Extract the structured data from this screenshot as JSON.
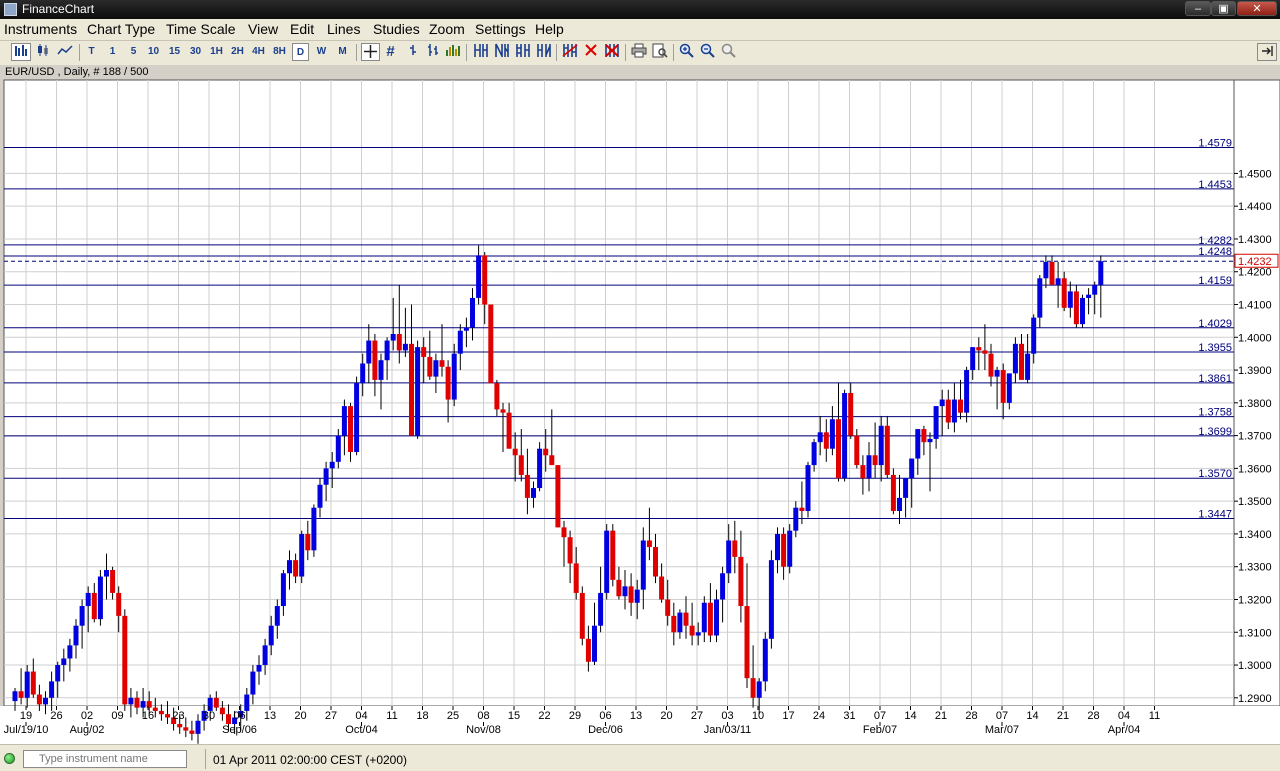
{
  "window": {
    "title": "FinanceChart"
  },
  "menu": [
    "Instruments",
    "Chart Type",
    "Time Scale",
    "View",
    "Edit",
    "Lines",
    "Studies",
    "Zoom",
    "Settings",
    "Help"
  ],
  "toolbar": {
    "timeframes": [
      "T",
      "1",
      "5",
      "10",
      "15",
      "30",
      "1H",
      "2H",
      "4H",
      "8H",
      "D",
      "W",
      "M"
    ],
    "selected_timeframe": "D",
    "hash": "#"
  },
  "symbol_info": "EUR/USD , Daily, # 188 / 500",
  "status": {
    "search_placeholder": "Type instrument name",
    "datetime": "01 Apr 2011 02:00:00  CEST (+0200)"
  },
  "colors": {
    "up": "#0000e0",
    "down": "#e00000",
    "line": "#00007a",
    "grid": "#cfcfcf",
    "current": "#d40000"
  },
  "chart_data": {
    "type": "candlestick",
    "ylim": [
      1.2875,
      1.4785
    ],
    "y_ticks": [
      1.29,
      1.3,
      1.31,
      1.32,
      1.33,
      1.34,
      1.35,
      1.36,
      1.37,
      1.38,
      1.39,
      1.4,
      1.41,
      1.42,
      1.43,
      1.44,
      1.45
    ],
    "x_ticks": [
      "19",
      "26",
      "02",
      "09",
      "16",
      "23",
      "30",
      "06",
      "13",
      "20",
      "27",
      "04",
      "11",
      "18",
      "25",
      "08",
      "15",
      "22",
      "29",
      "06",
      "13",
      "20",
      "27",
      "03",
      "10",
      "17",
      "24",
      "31",
      "07",
      "14",
      "21",
      "28",
      "07",
      "14",
      "21",
      "28",
      "04",
      "11"
    ],
    "x_month_labels": [
      {
        "label": "Jul/19/10",
        "at": 0
      },
      {
        "label": "Aug/02",
        "at": 2
      },
      {
        "label": "Sep/06",
        "at": 7
      },
      {
        "label": "Oct/04",
        "at": 11
      },
      {
        "label": "Nov/08",
        "at": 15
      },
      {
        "label": "Dec/06",
        "at": 19
      },
      {
        "label": "Jan/03/11",
        "at": 23
      },
      {
        "label": "Feb/07",
        "at": 28
      },
      {
        "label": "Mar/07",
        "at": 32
      },
      {
        "label": "Apr/04",
        "at": 36
      }
    ],
    "horizontal_lines": [
      1.4579,
      1.4453,
      1.4282,
      1.4248,
      1.4159,
      1.4029,
      1.3955,
      1.3861,
      1.3758,
      1.3699,
      1.357,
      1.3447
    ],
    "current_price": 1.4232,
    "candles": [
      [
        1.289,
        1.293,
        1.286,
        1.292
      ],
      [
        1.292,
        1.299,
        1.288,
        1.29
      ],
      [
        1.29,
        1.3,
        1.287,
        1.298
      ],
      [
        1.298,
        1.302,
        1.29,
        1.291
      ],
      [
        1.291,
        1.294,
        1.286,
        1.288
      ],
      [
        1.288,
        1.292,
        1.285,
        1.29
      ],
      [
        1.29,
        1.298,
        1.286,
        1.295
      ],
      [
        1.295,
        1.301,
        1.29,
        1.3
      ],
      [
        1.3,
        1.305,
        1.295,
        1.302
      ],
      [
        1.302,
        1.308,
        1.298,
        1.306
      ],
      [
        1.306,
        1.314,
        1.302,
        1.312
      ],
      [
        1.312,
        1.32,
        1.305,
        1.318
      ],
      [
        1.318,
        1.324,
        1.31,
        1.322
      ],
      [
        1.322,
        1.325,
        1.313,
        1.314
      ],
      [
        1.314,
        1.329,
        1.312,
        1.327
      ],
      [
        1.327,
        1.334,
        1.32,
        1.329
      ],
      [
        1.329,
        1.33,
        1.32,
        1.322
      ],
      [
        1.322,
        1.324,
        1.31,
        1.315
      ],
      [
        1.315,
        1.317,
        1.286,
        1.288
      ],
      [
        1.288,
        1.293,
        1.284,
        1.29
      ],
      [
        1.29,
        1.292,
        1.285,
        1.287
      ],
      [
        1.287,
        1.293,
        1.284,
        1.289
      ],
      [
        1.289,
        1.292,
        1.285,
        1.287
      ],
      [
        1.287,
        1.29,
        1.284,
        1.286
      ],
      [
        1.286,
        1.288,
        1.283,
        1.285
      ],
      [
        1.285,
        1.289,
        1.282,
        1.284
      ],
      [
        1.284,
        1.287,
        1.28,
        1.282
      ],
      [
        1.282,
        1.285,
        1.279,
        1.281
      ],
      [
        1.281,
        1.284,
        1.278,
        1.28
      ],
      [
        1.28,
        1.283,
        1.277,
        1.279
      ],
      [
        1.279,
        1.285,
        1.276,
        1.283
      ],
      [
        1.283,
        1.288,
        1.28,
        1.286
      ],
      [
        1.286,
        1.291,
        1.283,
        1.29
      ],
      [
        1.29,
        1.292,
        1.286,
        1.287
      ],
      [
        1.287,
        1.289,
        1.283,
        1.285
      ],
      [
        1.285,
        1.288,
        1.28,
        1.282
      ],
      [
        1.282,
        1.286,
        1.279,
        1.284
      ],
      [
        1.284,
        1.288,
        1.28,
        1.286
      ],
      [
        1.286,
        1.293,
        1.283,
        1.291
      ],
      [
        1.291,
        1.3,
        1.288,
        1.298
      ],
      [
        1.298,
        1.303,
        1.294,
        1.3
      ],
      [
        1.3,
        1.308,
        1.297,
        1.306
      ],
      [
        1.306,
        1.315,
        1.303,
        1.312
      ],
      [
        1.312,
        1.32,
        1.308,
        1.318
      ],
      [
        1.318,
        1.329,
        1.315,
        1.328
      ],
      [
        1.328,
        1.335,
        1.323,
        1.332
      ],
      [
        1.332,
        1.334,
        1.325,
        1.327
      ],
      [
        1.327,
        1.341,
        1.325,
        1.34
      ],
      [
        1.34,
        1.344,
        1.332,
        1.335
      ],
      [
        1.335,
        1.349,
        1.333,
        1.348
      ],
      [
        1.348,
        1.357,
        1.345,
        1.355
      ],
      [
        1.355,
        1.362,
        1.35,
        1.36
      ],
      [
        1.36,
        1.365,
        1.354,
        1.362
      ],
      [
        1.362,
        1.372,
        1.36,
        1.37
      ],
      [
        1.37,
        1.381,
        1.364,
        1.379
      ],
      [
        1.379,
        1.38,
        1.362,
        1.365
      ],
      [
        1.365,
        1.388,
        1.364,
        1.386
      ],
      [
        1.386,
        1.395,
        1.382,
        1.392
      ],
      [
        1.392,
        1.404,
        1.386,
        1.399
      ],
      [
        1.399,
        1.401,
        1.382,
        1.387
      ],
      [
        1.387,
        1.395,
        1.378,
        1.393
      ],
      [
        1.393,
        1.4,
        1.387,
        1.399
      ],
      [
        1.399,
        1.412,
        1.396,
        1.401
      ],
      [
        1.401,
        1.416,
        1.392,
        1.396
      ],
      [
        1.396,
        1.409,
        1.394,
        1.398
      ],
      [
        1.398,
        1.41,
        1.372,
        1.37
      ],
      [
        1.37,
        1.399,
        1.369,
        1.397
      ],
      [
        1.397,
        1.4,
        1.386,
        1.394
      ],
      [
        1.394,
        1.402,
        1.387,
        1.388
      ],
      [
        1.388,
        1.395,
        1.383,
        1.393
      ],
      [
        1.393,
        1.404,
        1.388,
        1.391
      ],
      [
        1.391,
        1.393,
        1.374,
        1.381
      ],
      [
        1.381,
        1.398,
        1.379,
        1.395
      ],
      [
        1.395,
        1.404,
        1.39,
        1.402
      ],
      [
        1.402,
        1.406,
        1.397,
        1.403
      ],
      [
        1.403,
        1.415,
        1.399,
        1.412
      ],
      [
        1.412,
        1.428,
        1.41,
        1.425
      ],
      [
        1.425,
        1.426,
        1.404,
        1.41
      ],
      [
        1.41,
        1.409,
        1.39,
        1.386
      ],
      [
        1.386,
        1.387,
        1.376,
        1.378
      ],
      [
        1.378,
        1.38,
        1.365,
        1.377
      ],
      [
        1.377,
        1.38,
        1.366,
        1.366
      ],
      [
        1.366,
        1.371,
        1.356,
        1.364
      ],
      [
        1.364,
        1.372,
        1.356,
        1.358
      ],
      [
        1.358,
        1.366,
        1.346,
        1.351
      ],
      [
        1.351,
        1.356,
        1.348,
        1.354
      ],
      [
        1.354,
        1.368,
        1.353,
        1.366
      ],
      [
        1.366,
        1.372,
        1.359,
        1.364
      ],
      [
        1.364,
        1.378,
        1.361,
        1.361
      ],
      [
        1.361,
        1.361,
        1.342,
        1.342
      ],
      [
        1.342,
        1.344,
        1.33,
        1.339
      ],
      [
        1.339,
        1.341,
        1.325,
        1.331
      ],
      [
        1.331,
        1.336,
        1.32,
        1.322
      ],
      [
        1.322,
        1.324,
        1.306,
        1.308
      ],
      [
        1.308,
        1.312,
        1.298,
        1.301
      ],
      [
        1.301,
        1.319,
        1.3,
        1.312
      ],
      [
        1.312,
        1.33,
        1.31,
        1.322
      ],
      [
        1.322,
        1.343,
        1.32,
        1.341
      ],
      [
        1.341,
        1.343,
        1.324,
        1.326
      ],
      [
        1.326,
        1.33,
        1.32,
        1.321
      ],
      [
        1.321,
        1.329,
        1.317,
        1.324
      ],
      [
        1.324,
        1.328,
        1.315,
        1.319
      ],
      [
        1.319,
        1.326,
        1.314,
        1.323
      ],
      [
        1.323,
        1.342,
        1.317,
        1.338
      ],
      [
        1.338,
        1.348,
        1.332,
        1.336
      ],
      [
        1.336,
        1.34,
        1.325,
        1.327
      ],
      [
        1.327,
        1.331,
        1.319,
        1.32
      ],
      [
        1.32,
        1.326,
        1.312,
        1.315
      ],
      [
        1.315,
        1.319,
        1.306,
        1.31
      ],
      [
        1.31,
        1.317,
        1.308,
        1.316
      ],
      [
        1.316,
        1.321,
        1.308,
        1.312
      ],
      [
        1.312,
        1.319,
        1.306,
        1.309
      ],
      [
        1.309,
        1.313,
        1.306,
        1.31
      ],
      [
        1.31,
        1.321,
        1.307,
        1.319
      ],
      [
        1.319,
        1.325,
        1.307,
        1.309
      ],
      [
        1.309,
        1.323,
        1.307,
        1.32
      ],
      [
        1.32,
        1.33,
        1.313,
        1.328
      ],
      [
        1.328,
        1.343,
        1.325,
        1.338
      ],
      [
        1.338,
        1.344,
        1.328,
        1.333
      ],
      [
        1.333,
        1.341,
        1.313,
        1.318
      ],
      [
        1.318,
        1.331,
        1.293,
        1.296
      ],
      [
        1.296,
        1.306,
        1.287,
        1.29
      ],
      [
        1.29,
        1.296,
        1.285,
        1.295
      ],
      [
        1.295,
        1.31,
        1.292,
        1.308
      ],
      [
        1.308,
        1.335,
        1.305,
        1.332
      ],
      [
        1.332,
        1.342,
        1.328,
        1.34
      ],
      [
        1.34,
        1.342,
        1.326,
        1.33
      ],
      [
        1.33,
        1.343,
        1.328,
        1.341
      ],
      [
        1.341,
        1.35,
        1.339,
        1.348
      ],
      [
        1.348,
        1.356,
        1.343,
        1.347
      ],
      [
        1.347,
        1.362,
        1.345,
        1.361
      ],
      [
        1.361,
        1.369,
        1.359,
        1.368
      ],
      [
        1.368,
        1.376,
        1.364,
        1.371
      ],
      [
        1.371,
        1.375,
        1.362,
        1.366
      ],
      [
        1.366,
        1.379,
        1.364,
        1.375
      ],
      [
        1.375,
        1.386,
        1.356,
        1.357
      ],
      [
        1.357,
        1.384,
        1.356,
        1.383
      ],
      [
        1.383,
        1.386,
        1.369,
        1.37
      ],
      [
        1.37,
        1.372,
        1.36,
        1.361
      ],
      [
        1.361,
        1.364,
        1.352,
        1.357
      ],
      [
        1.357,
        1.368,
        1.353,
        1.364
      ],
      [
        1.364,
        1.374,
        1.357,
        1.361
      ],
      [
        1.361,
        1.376,
        1.356,
        1.373
      ],
      [
        1.373,
        1.376,
        1.357,
        1.358
      ],
      [
        1.358,
        1.36,
        1.346,
        1.347
      ],
      [
        1.347,
        1.358,
        1.343,
        1.351
      ],
      [
        1.351,
        1.356,
        1.345,
        1.357
      ],
      [
        1.357,
        1.363,
        1.348,
        1.363
      ],
      [
        1.363,
        1.371,
        1.358,
        1.372
      ],
      [
        1.372,
        1.373,
        1.364,
        1.368
      ],
      [
        1.368,
        1.371,
        1.353,
        1.369
      ],
      [
        1.369,
        1.379,
        1.366,
        1.379
      ],
      [
        1.379,
        1.384,
        1.37,
        1.381
      ],
      [
        1.381,
        1.384,
        1.372,
        1.374
      ],
      [
        1.374,
        1.386,
        1.371,
        1.381
      ],
      [
        1.381,
        1.387,
        1.375,
        1.377
      ],
      [
        1.377,
        1.391,
        1.374,
        1.39
      ],
      [
        1.39,
        1.396,
        1.387,
        1.397
      ],
      [
        1.397,
        1.4,
        1.39,
        1.396
      ],
      [
        1.396,
        1.404,
        1.39,
        1.395
      ],
      [
        1.395,
        1.398,
        1.385,
        1.388
      ],
      [
        1.388,
        1.391,
        1.378,
        1.39
      ],
      [
        1.39,
        1.392,
        1.375,
        1.38
      ],
      [
        1.38,
        1.388,
        1.378,
        1.389
      ],
      [
        1.389,
        1.4,
        1.386,
        1.398
      ],
      [
        1.398,
        1.401,
        1.389,
        1.387
      ],
      [
        1.387,
        1.401,
        1.386,
        1.395
      ],
      [
        1.395,
        1.407,
        1.392,
        1.406
      ],
      [
        1.406,
        1.419,
        1.403,
        1.418
      ],
      [
        1.418,
        1.425,
        1.415,
        1.423
      ],
      [
        1.423,
        1.425,
        1.416,
        1.416
      ],
      [
        1.416,
        1.423,
        1.409,
        1.418
      ],
      [
        1.418,
        1.42,
        1.408,
        1.409
      ],
      [
        1.409,
        1.417,
        1.406,
        1.414
      ],
      [
        1.414,
        1.416,
        1.403,
        1.404
      ],
      [
        1.404,
        1.413,
        1.403,
        1.412
      ],
      [
        1.412,
        1.415,
        1.407,
        1.413
      ],
      [
        1.413,
        1.417,
        1.407,
        1.416
      ],
      [
        1.416,
        1.425,
        1.406,
        1.4232
      ]
    ]
  }
}
